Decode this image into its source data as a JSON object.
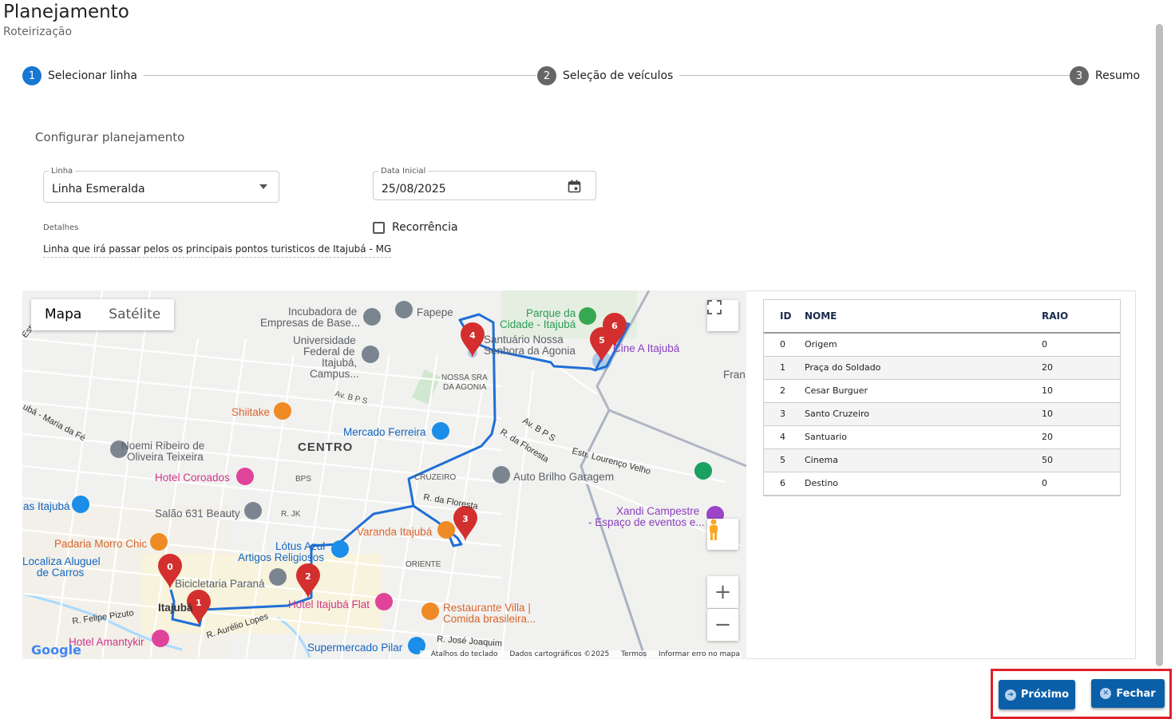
{
  "header": {
    "title": "Planejamento",
    "subtitle": "Roteirização"
  },
  "stepper": {
    "steps": [
      {
        "number": "1",
        "label": "Selecionar linha",
        "state": "active"
      },
      {
        "number": "2",
        "label": "Seleção de veículos",
        "state": "inactive"
      },
      {
        "number": "3",
        "label": "Resumo",
        "state": "inactive"
      }
    ]
  },
  "form": {
    "title": "Configurar planejamento",
    "linha": {
      "label": "Linha",
      "value": "Linha Esmeralda"
    },
    "data_inicial": {
      "label": "Data Inicial",
      "value": "25/08/2025",
      "icon": "calendar-icon"
    },
    "detalhes": {
      "label": "Detalhes",
      "value": "Linha que irá passar pelos os principais pontos turisticos de Itajubá - MG"
    },
    "recorrencia": {
      "label": "Recorrência",
      "checked": false
    }
  },
  "map": {
    "type_buttons": [
      "Mapa",
      "Satélite"
    ],
    "selected_type": "Mapa",
    "labels": {
      "incubadora": "Incubadora de",
      "empresas": "Empresas de Base...",
      "fapepe": "Fapepe",
      "parque1": "Parque da",
      "parque2": "Cidade - Itajubá",
      "santuario1": "Santuário Nossa",
      "santuario2": "Senhora da Agonia",
      "cine": "Cine A Itajubá",
      "univ1": "Universidade",
      "univ2": "Federal de",
      "univ3": "Itajubá,",
      "univ4": "Campus...",
      "nossa1": "NOSSA SRA",
      "nossa2": "DA AGONIA",
      "fran": "Fran",
      "shiitake": "Shiitake",
      "avbps": "Av. B P S",
      "centro": "CENTRO",
      "mercado": "Mercado Ferreira",
      "rfloresta1": "R. da Floresta",
      "avbps2": "Av. B P S",
      "estr": "Estr. Lourenço Velho",
      "noemi1": "Noemi Ribeiro de",
      "noemi2": "Oliveira Teixeira",
      "hotelcor": "Hotel Coroados",
      "bps": "BPS",
      "cruzeiro": "CRUZEIRO",
      "autobrilho": "Auto Brilho Garagem",
      "asitajuba": "as Itajubá",
      "salao": "Salão 631 Beauty",
      "rjk": "R. JK",
      "rfloresta2": "R. da Floresta",
      "xandi1": "Xandi Campestre",
      "xandi2": "- Espaço de eventos e...",
      "varanda": "Varanda Itajubá",
      "padaria": "Padaria Morro Chic",
      "lotus1": "Lótus Azul",
      "lotus2": "Artigos Religiosos",
      "localiza1": "Localiza Aluguel",
      "localiza2": "de Carros",
      "oriente": "ORIENTE",
      "bicicletaria": "Bicicletaria Paraná",
      "hotelflat": "Hotel Itajubá Flat",
      "itajuba": "Itajubá",
      "restaurante1": "Restaurante Villa |",
      "restaurante2": "Comida brasileira...",
      "felipe": "R. Felipe Pizuto",
      "aurelio": "R. Aurélio Lopes",
      "hotelamantykir": "Hotel Amantykir",
      "rjose": "R. José Joaquim",
      "supermercado": "Supermercado Pilar",
      "mariafe": "ubá - Maria da Fé",
      "estr2": "Estr."
    },
    "markers": [
      "0",
      "1",
      "2",
      "3",
      "4",
      "5",
      "6"
    ],
    "footer": {
      "keyboard": "Atalhos do teclado",
      "data": "Dados cartográficos ©2025",
      "terms": "Termos",
      "report": "Informar erro no mapa"
    },
    "logo": "Google",
    "controls": {
      "zoom_in": "+",
      "zoom_out": "−"
    }
  },
  "table": {
    "columns": [
      "ID",
      "NOME",
      "RAIO"
    ],
    "rows": [
      {
        "id": "0",
        "nome": "Origem",
        "raio": "0"
      },
      {
        "id": "1",
        "nome": "Praça do Soldado",
        "raio": "20"
      },
      {
        "id": "2",
        "nome": "Cesar Burguer",
        "raio": "10"
      },
      {
        "id": "3",
        "nome": "Santo Cruzeiro",
        "raio": "10"
      },
      {
        "id": "4",
        "nome": "Santuario",
        "raio": "20"
      },
      {
        "id": "5",
        "nome": "Cinema",
        "raio": "50"
      },
      {
        "id": "6",
        "nome": "Destino",
        "raio": "0"
      }
    ]
  },
  "actions": {
    "next": "Próximo",
    "close": "Fechar"
  },
  "colors": {
    "primary": "#0b5fa8",
    "step_active": "#1976d2",
    "step_inactive": "#666666",
    "route": "#1f6fd6",
    "marker": "#d32f2f",
    "highlight": "#e0202a"
  }
}
